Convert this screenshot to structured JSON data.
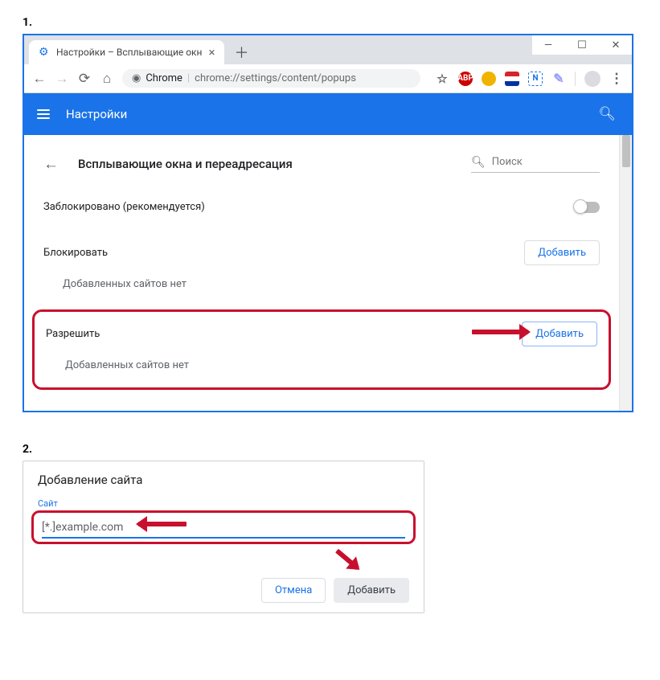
{
  "step1_label": "1.",
  "step2_label": "2.",
  "tab": {
    "title": "Настройки – Всплывающие окн"
  },
  "omnibox": {
    "protocol": "Chrome",
    "url": "chrome://settings/content/popups"
  },
  "header": {
    "title": "Настройки"
  },
  "page": {
    "title": "Всплывающие окна и переадресация",
    "search_placeholder": "Поиск",
    "blocked_label": "Заблокировано (рекомендуется)",
    "section_block": {
      "label": "Блокировать",
      "add": "Добавить",
      "empty": "Добавленных сайтов нет"
    },
    "section_allow": {
      "label": "Разрешить",
      "add": "Добавить",
      "empty": "Добавленных сайтов нет"
    }
  },
  "dialog": {
    "title": "Добавление сайта",
    "field_label": "Сайт",
    "field_value": "[*.]example.com",
    "cancel": "Отмена",
    "submit": "Добавить"
  }
}
